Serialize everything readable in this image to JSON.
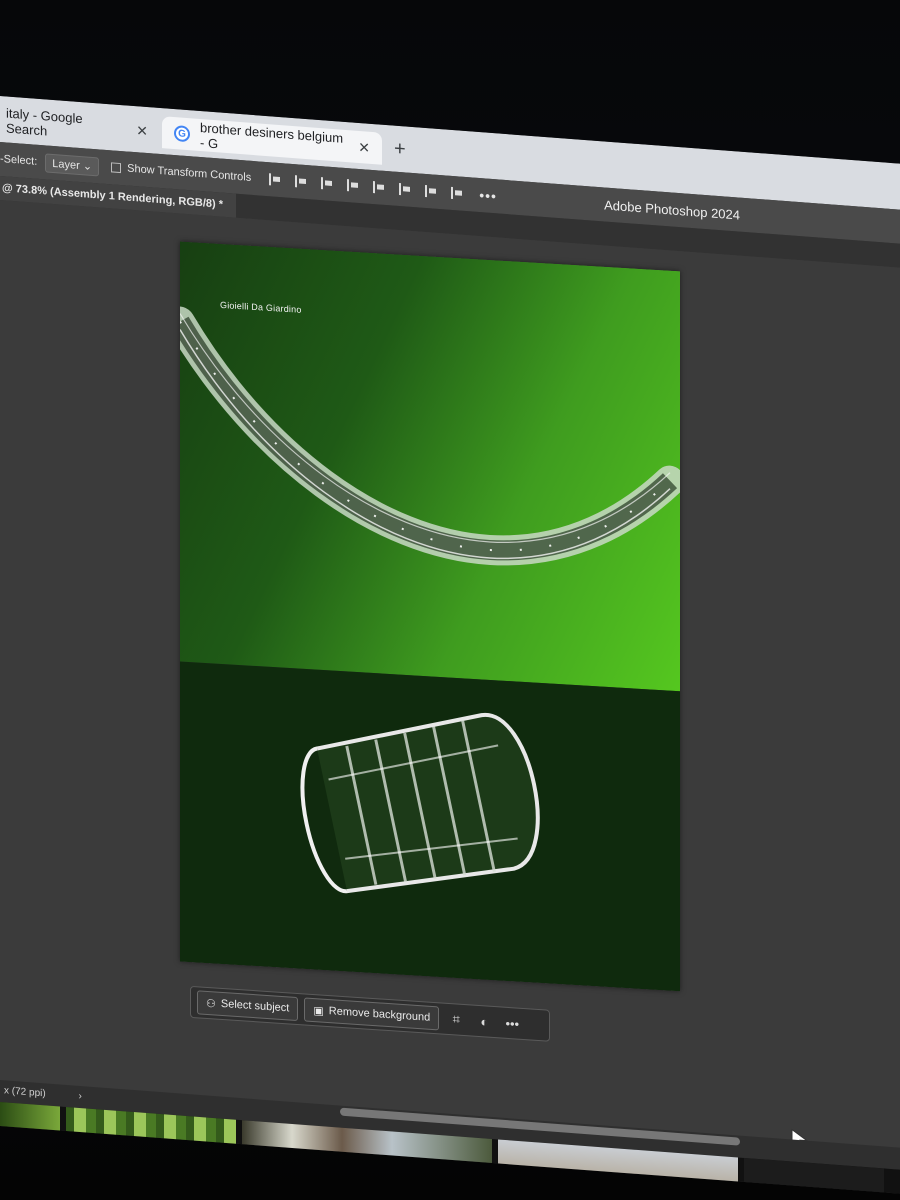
{
  "browser": {
    "tabs": [
      {
        "title": "italy - Google Search"
      },
      {
        "title": "brother desiners belgium - G"
      }
    ],
    "new_tab_symbol": "+"
  },
  "options_bar": {
    "auto_select_label": "-Select:",
    "layer_select_value": "Layer",
    "show_transform_label": "Show Transform Controls",
    "more": "•••"
  },
  "app": {
    "name": "Adobe Photoshop 2024"
  },
  "document_tab": {
    "title": "@ 73.8% (Assembly 1 Rendering, RGB/8) *"
  },
  "artboard": {
    "brand_text": "Gioielli Da Giardino",
    "colors": {
      "green_bright": "#55c71f",
      "green_dark": "#0f2a0d"
    }
  },
  "context_bar": {
    "select_subject": "Select subject",
    "remove_background": "Remove background",
    "more": "•••"
  },
  "status_bar": {
    "resolution": "x (72 ppi)",
    "arrow": "›"
  }
}
